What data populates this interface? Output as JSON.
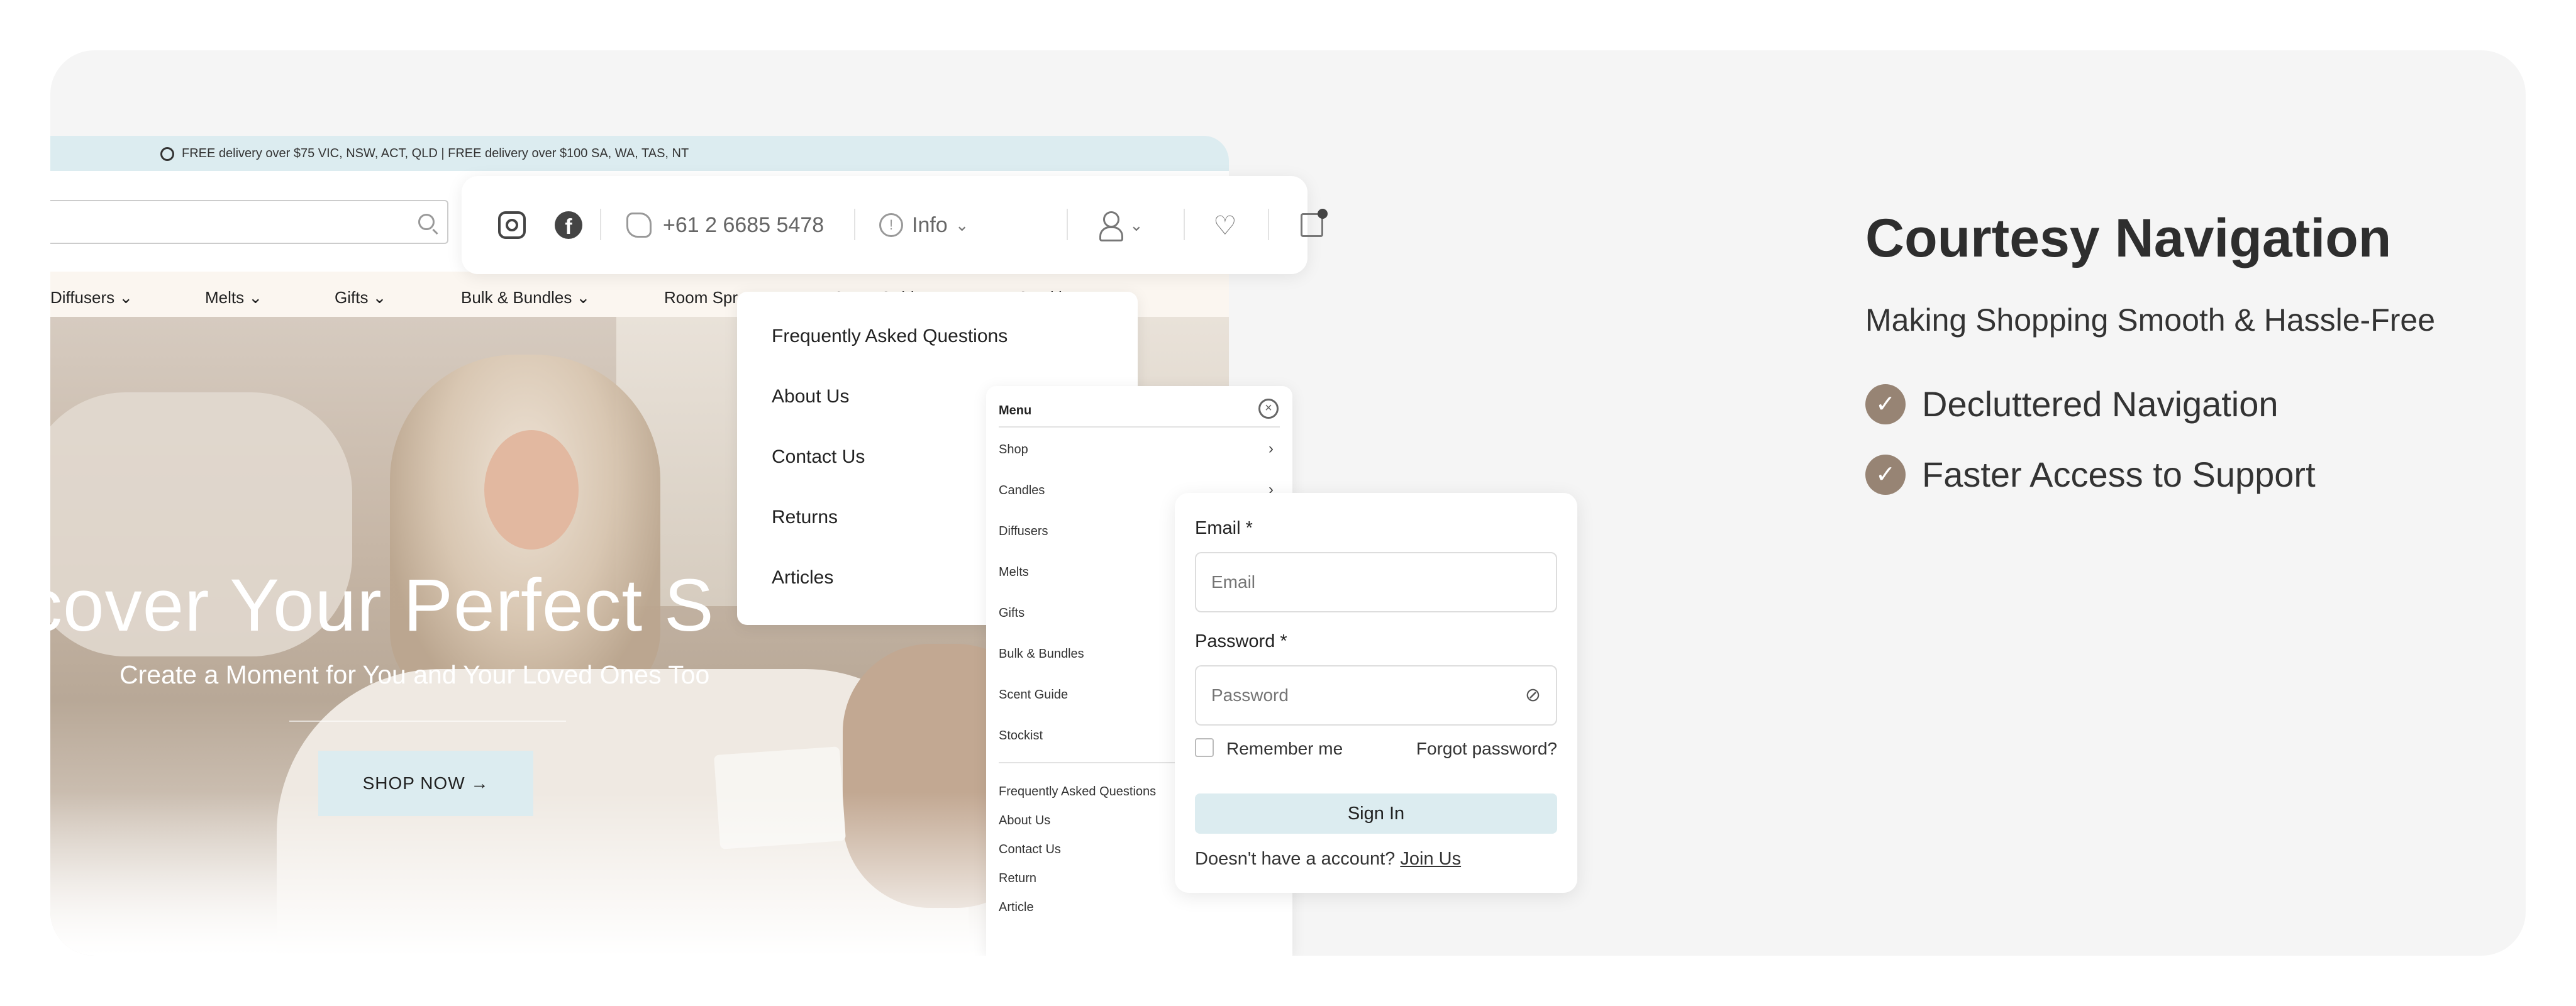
{
  "topbar": {
    "text": "FREE delivery over $75 VIC, NSW, ACT, QLD | FREE delivery over $100 SA, WA, TAS, NT"
  },
  "nav": {
    "items": [
      "Diffusers",
      "Melts",
      "Gifts",
      "Bulk & Bundles",
      "Room Spr",
      "Scent Guid",
      "Stockist"
    ]
  },
  "hero": {
    "headline": "cover Your Perfect S",
    "subline": "Create a Moment for You and Your Loved Ones Too",
    "cta": "SHOP NOW"
  },
  "util": {
    "phone": "+61 2 6685 5478",
    "info": "Info"
  },
  "info_dropdown": {
    "items": [
      "Frequently Asked Questions",
      "About Us",
      "Contact Us",
      "Returns",
      "Articles"
    ]
  },
  "menu": {
    "title": "Menu",
    "main_items": [
      "Shop",
      "Candles",
      "Diffusers",
      "Melts",
      "Gifts",
      "Bulk & Bundles",
      "Scent Guide",
      "Stockist"
    ],
    "secondary_items": [
      "Frequently Asked Questions",
      "About Us",
      "Contact Us",
      "Return",
      "Article"
    ]
  },
  "login": {
    "email_label": "Email *",
    "email_placeholder": "Email",
    "password_label": "Password *",
    "password_placeholder": "Password",
    "remember": "Remember me",
    "forgot": "Forgot password?",
    "signin": "Sign In",
    "no_account": "Doesn't have a account?",
    "join": "Join Us"
  },
  "copy": {
    "title": "Courtesy Navigation",
    "subtitle": "Making Shopping Smooth & Hassle-Free",
    "points": [
      "Decluttered Navigation",
      "Faster Access to Support"
    ]
  },
  "colors": {
    "accent_blue": "#dcecf0",
    "check_brown": "#978474",
    "card_bg": "#f5f5f5"
  }
}
